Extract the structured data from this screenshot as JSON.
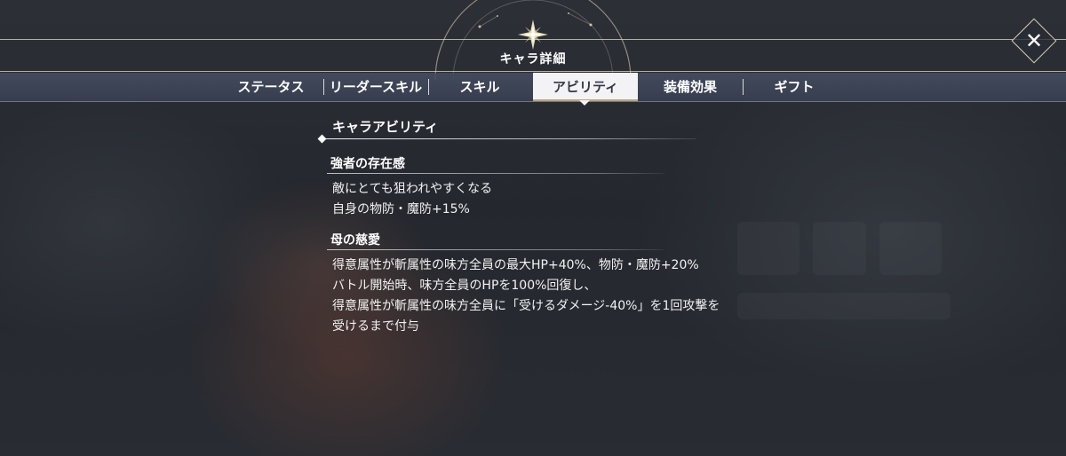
{
  "header": {
    "title": "キャラ詳細",
    "close_icon": "✕"
  },
  "tabs": [
    {
      "label": "ステータス",
      "active": false
    },
    {
      "label": "リーダースキル",
      "active": false
    },
    {
      "label": "スキル",
      "active": false
    },
    {
      "label": "アビリティ",
      "active": true
    },
    {
      "label": "装備効果",
      "active": false
    },
    {
      "label": "ギフト",
      "active": false
    }
  ],
  "content": {
    "section_title": "キャラアビリティ",
    "abilities": [
      {
        "name": "強者の存在感",
        "lines": [
          "敵にとても狙われやすくなる",
          "自身の物防・魔防+15%"
        ]
      },
      {
        "name": "母の慈愛",
        "lines": [
          "得意属性が斬属性の味方全員の最大HP+40%、物防・魔防+20%",
          "バトル開始時、味方全員のHPを100%回復し、",
          "得意属性が斬属性の味方全員に「受けるダメージ-40%」を1回攻撃を",
          "受けるまで付与"
        ]
      }
    ]
  },
  "colors": {
    "accent_gold": "#d8ccaa",
    "tab_bar": "#3f4760",
    "active_tab_bg": "#f3f3f5",
    "active_tab_text": "#333844"
  }
}
